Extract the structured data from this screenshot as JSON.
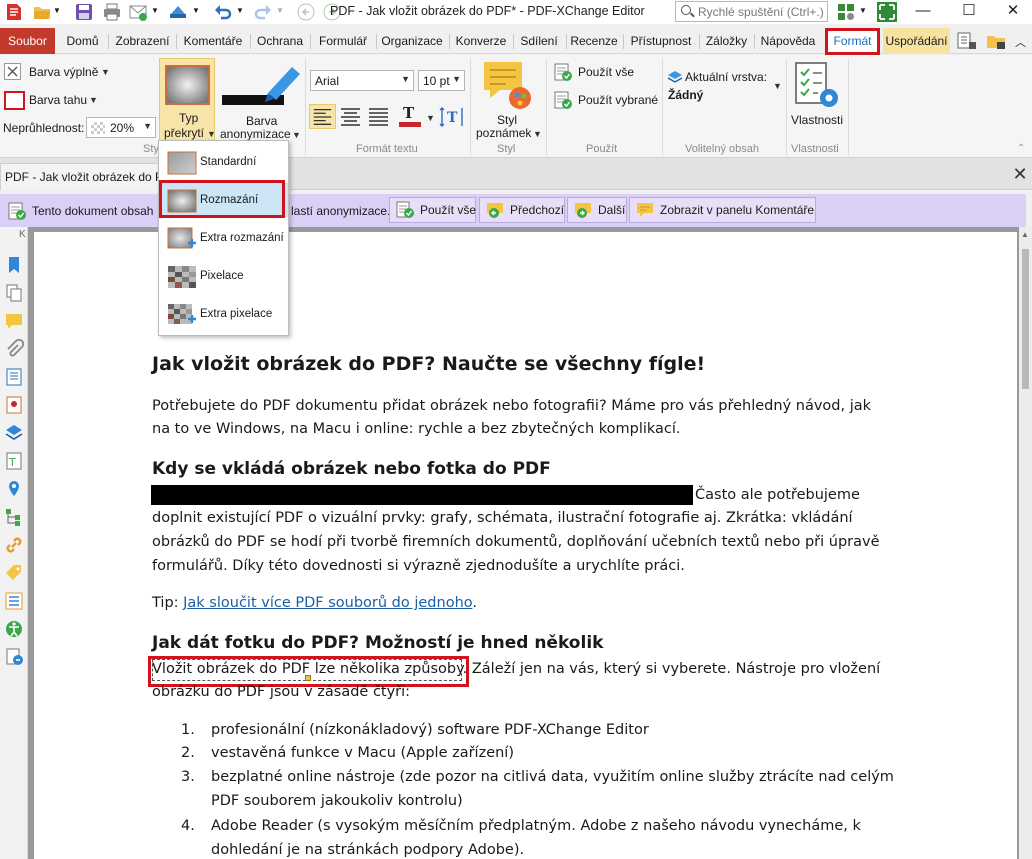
{
  "window": {
    "title": "PDF - Jak vložit obrázek do PDF* - PDF-XChange Editor",
    "search_placeholder": "Rychlé spuštění (Ctrl+.)",
    "controls": [
      "—",
      "☐",
      "✕"
    ]
  },
  "menu": {
    "items": [
      "Soubor",
      "Domů",
      "Zobrazení",
      "Komentáře",
      "Ochrana",
      "Formulář",
      "Organizace",
      "Konverze",
      "Sdílení",
      "Recenze",
      "Přístupnost",
      "Záložky",
      "Nápověda",
      "Formát",
      "Uspořádání"
    ],
    "active": "Formát"
  },
  "ribbon": {
    "fill_color_label": "Barva výplně",
    "stroke_color_label": "Barva tahu",
    "opacity_label": "Neprůhlednost:",
    "opacity_value": "20%",
    "styl_group_label": "Styl",
    "overlay_type_label_1": "Typ",
    "overlay_type_label_2": "překrytí",
    "redaction_color_label_1": "Barva",
    "redaction_color_label_2": "anonymizace",
    "font_name": "Arial",
    "font_size": "10 pt",
    "text_format_group": "Formát textu",
    "note_style_label_1": "Styl",
    "note_style_label_2": "poznámek",
    "style_group": "Styl",
    "apply_all": "Použít vše",
    "apply_selected": "Použít vybrané",
    "apply_group": "Použít",
    "current_layer_label": "Aktuální vrstva:",
    "current_layer_value": "Žádný",
    "optional_content_group": "Volitelný obsah",
    "properties_label": "Vlastnosti",
    "properties_group": "Vlastnosti",
    "accent_red": "#c6262e",
    "accent_blue": "#2f87d6"
  },
  "tab": {
    "document_tab": "PDF - Jak vložit obrázek do PDF"
  },
  "notification": {
    "message": "Tento dokument obsahuje vyznačení oblastí anonymizace.",
    "message_visible_part": "lastí anonymizace.",
    "apply_all": "Použít vše",
    "previous": "Předchozí",
    "next": "Další",
    "show_in_panel": "Zobrazit v panelu Komentáře",
    "background": "#dccff7"
  },
  "dropdown": {
    "items": [
      "Standardní",
      "Rozmazání",
      "Extra rozmazání",
      "Pixelace",
      "Extra pixelace"
    ],
    "selected": "Rozmazání"
  },
  "document": {
    "heading1": "Jak vložit obrázek do PDF? Naučte se všechny fígle!",
    "intro_line1": "Potřebujete do PDF dokumentu přidat obrázek nebo fotografii? Máme pro vás přehledný návod, jak",
    "intro_line2": "na to ve Windows, na Macu i online: rychle a bez zbytečných komplikací.",
    "heading2": "Kdy se vkládá obrázek nebo fotka do PDF",
    "redacted_tail": "Často ale potřebujeme",
    "para2_line2": "doplnit existující PDF o vizuální prvky: grafy, schémata, ilustrační fotografie aj. Zkrátka: vkládání",
    "para2_line3": "obrázků do PDF se hodí při tvorbě firemních dokumentů, doplňování učebních textů nebo při úpravě",
    "para2_line4": "formulářů. Díky této dovednosti si výrazně zjednodušíte a urychlíte práci.",
    "tip_prefix": "Tip: ",
    "tip_link": "Jak sloučit více PDF souborů do jednoho",
    "tip_suffix": ".",
    "heading3": "Jak dát fotku do PDF? Možností je hned několik",
    "para3_selected": "Vložit obrázek do PDF lze několika způsoby.",
    "para3_rest": " Záleží jen na vás, který si vyberete. Nástroje pro vložení",
    "para3_line2": "obrázku do PDF jsou v zásadě čtyři:",
    "list": [
      {
        "num": "1.",
        "lines": [
          "profesionální (nízkonákladový) software PDF-XChange Editor"
        ]
      },
      {
        "num": "2.",
        "lines": [
          "vestavěná funkce v Macu (Apple zařízení)"
        ]
      },
      {
        "num": "3.",
        "lines": [
          "bezplatné online nástroje (zde pozor na citlivá data, využitím online služby ztrácíte nad celým",
          "PDF souborem jakoukoliv kontrolu)"
        ]
      },
      {
        "num": "4.",
        "lines": [
          "Adobe Reader (s vysokým měsíčním předplatným. Adobe z našeho návodu vynecháme, k",
          "dohledání je na stránkách podpory Adobe)."
        ]
      }
    ]
  }
}
